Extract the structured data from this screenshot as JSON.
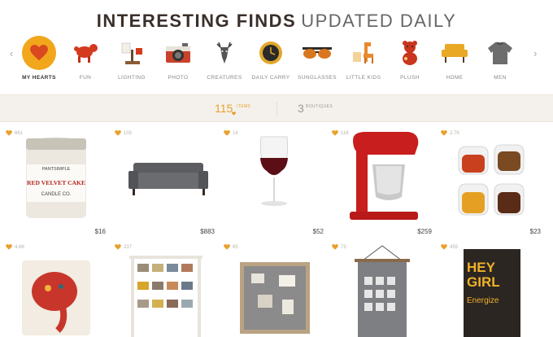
{
  "header": {
    "title_bold": "INTERESTING FINDS",
    "title_light": "UPDATED DAILY"
  },
  "categories": [
    {
      "label": "MY HEARTS",
      "icon": "heart-icon",
      "active": true
    },
    {
      "label": "FUN",
      "icon": "toy-dog-icon"
    },
    {
      "label": "LIGHTING",
      "icon": "lamp-icon"
    },
    {
      "label": "PHOTO",
      "icon": "camera-icon"
    },
    {
      "label": "CREATURES",
      "icon": "deer-head-icon"
    },
    {
      "label": "DAILY CARRY",
      "icon": "watch-icon"
    },
    {
      "label": "SUNGLASSES",
      "icon": "sunglasses-icon"
    },
    {
      "label": "LITTLE KIDS",
      "icon": "giraffe-icon"
    },
    {
      "label": "PLUSH",
      "icon": "plush-icon"
    },
    {
      "label": "HOME",
      "icon": "armchair-icon"
    },
    {
      "label": "MEN",
      "icon": "sweater-icon"
    }
  ],
  "stats": {
    "items_count": "115",
    "items_label": "ITEMS",
    "boutiques_count": "3",
    "boutiques_label": "BOUTIQUES"
  },
  "products": [
    {
      "likes": "661",
      "price": "$16",
      "image": "candle-jar-red-velvet-cake",
      "candle_brand": "PANTSIMPLE",
      "candle_name": "RED VELVET CAKE",
      "candle_sub": "CANDLE CO."
    },
    {
      "likes": "103",
      "price": "$883",
      "image": "gray-sofa"
    },
    {
      "likes": "14",
      "price": "$52",
      "image": "wine-glass"
    },
    {
      "likes": "118",
      "price": "$259",
      "image": "red-stand-mixer"
    },
    {
      "likes": "2.7K",
      "price": "$23",
      "image": "animal-shot-glasses"
    },
    {
      "likes": "4.6K",
      "price": "",
      "image": "elephant-pillow"
    },
    {
      "likes": "237",
      "price": "",
      "image": "photo-clip-display"
    },
    {
      "likes": "65",
      "price": "",
      "image": "pin-board"
    },
    {
      "likes": "73",
      "price": "",
      "image": "hanging-calendar"
    },
    {
      "likes": "455",
      "price": "",
      "image": "hey-girl-energize-tea",
      "pack_l1": "HEY",
      "pack_l2": "GIRL",
      "pack_l3": "Energize"
    }
  ],
  "colors": {
    "accent": "#f2a61c",
    "stats_bg": "#f4f1ec"
  }
}
